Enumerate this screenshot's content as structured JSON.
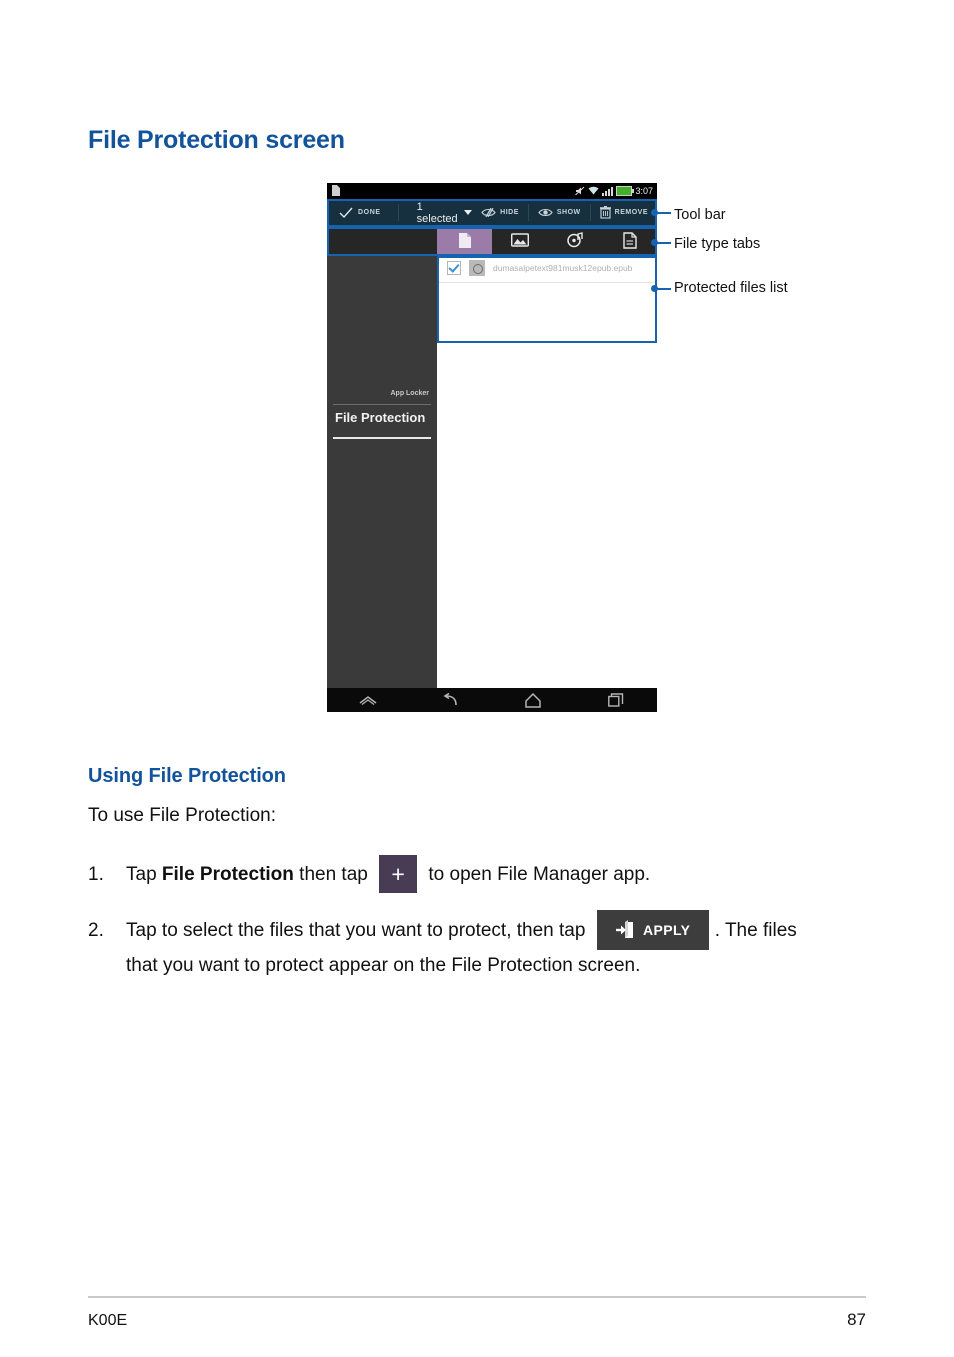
{
  "document": {
    "heading": "File Protection screen",
    "section_heading": "Using File Protection",
    "intro": "To use File Protection:",
    "steps": [
      {
        "number": "1.",
        "text_before": "Tap ",
        "bold": "File Protection",
        "text_mid": " then tap ",
        "icon": "plus-icon",
        "icon_glyph": "+",
        "text_after": " to open File Manager app."
      },
      {
        "number": "2.",
        "text_before": "Tap to select the files that you want to protect, then tap ",
        "icon": "apply-button-icon",
        "icon_label": "APPLY",
        "text_after": ". The files",
        "line2": "that you want to protect appear on the File Protection screen."
      }
    ],
    "footer": {
      "model": "K00E",
      "page_number": "87"
    }
  },
  "annotations": [
    {
      "label": "Tool bar"
    },
    {
      "label": "File type tabs"
    },
    {
      "label": "Protected files list"
    }
  ],
  "tablet": {
    "statusbar": {
      "time": "3:07",
      "icons": [
        "document-icon",
        "mute-icon",
        "wifi-icon",
        "signal-icon",
        "battery-icon"
      ]
    },
    "toolbar": {
      "done_label": "DONE",
      "done_icon": "check-icon",
      "selection_label": "1 selected",
      "selection_caret": "chevron-down-icon",
      "actions": [
        {
          "label": "HIDE",
          "icon": "eye-slash-icon"
        },
        {
          "label": "SHOW",
          "icon": "eye-icon"
        },
        {
          "label": "REMOVE",
          "icon": "trash-icon"
        }
      ]
    },
    "tabs": [
      {
        "name": "document-tab",
        "icon": "document-icon",
        "active": true
      },
      {
        "name": "image-tab",
        "icon": "image-icon",
        "active": false
      },
      {
        "name": "music-tab",
        "icon": "music-icon",
        "active": false
      },
      {
        "name": "file-tab",
        "icon": "file-icon",
        "active": false
      }
    ],
    "sidebar": {
      "app_locker_label": "App Locker",
      "file_protection_label": "File Protection"
    },
    "files": [
      {
        "name": "dumasalpetext981musk12epub.epub",
        "checked": true,
        "icon": "epub-file-icon"
      }
    ],
    "navbar": [
      {
        "name": "hide-nav-icon"
      },
      {
        "name": "back-icon"
      },
      {
        "name": "home-icon"
      },
      {
        "name": "recents-icon"
      }
    ]
  },
  "colors": {
    "heading_blue": "#12539b",
    "callout_blue": "#1663b0",
    "toolbar_navy": "#17303f",
    "tab_active_purple": "#9b7ba8",
    "battery_green": "#43b02a"
  }
}
